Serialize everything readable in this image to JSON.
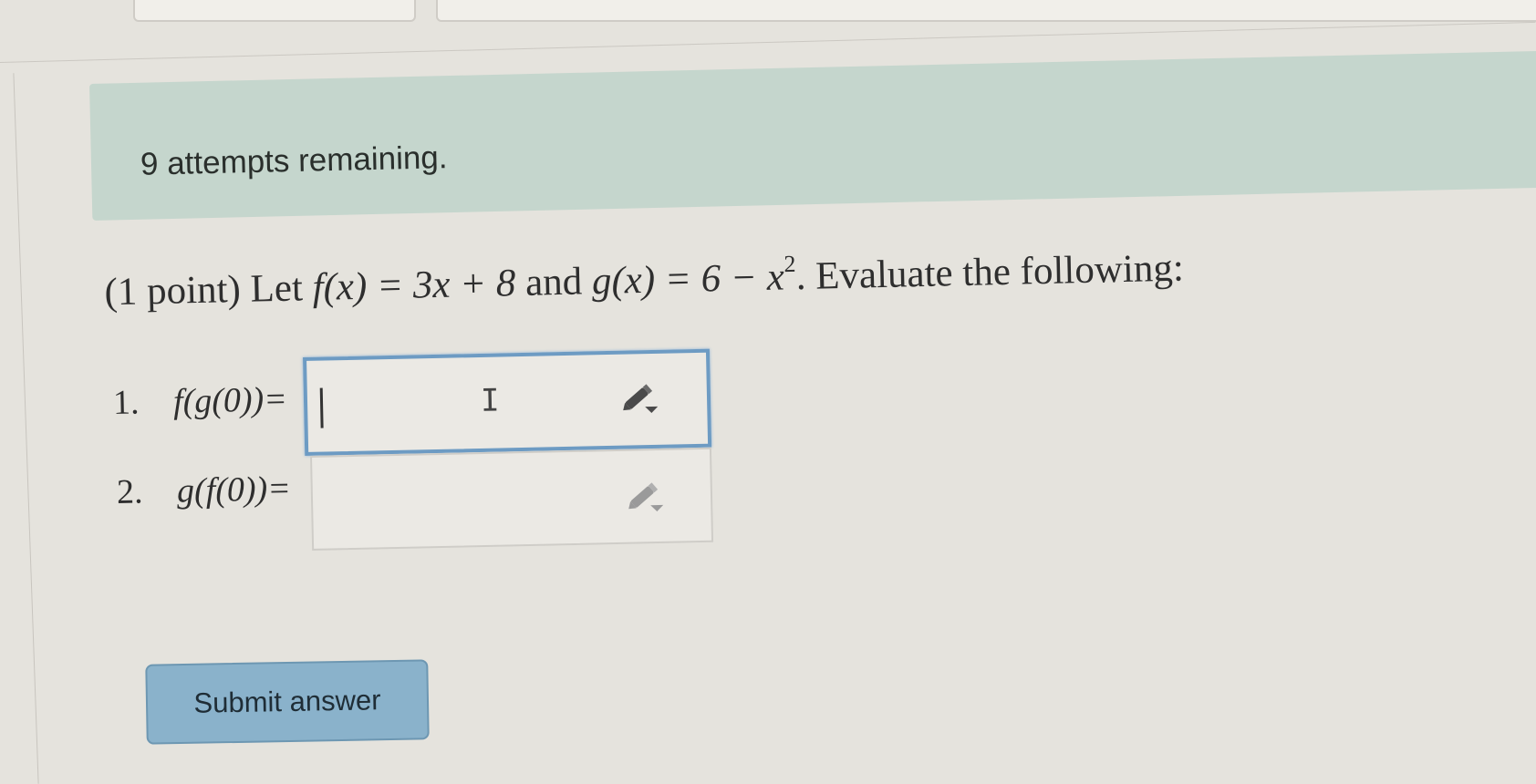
{
  "attempts": {
    "text": "9 attempts remaining."
  },
  "problem": {
    "points": "(1 point)",
    "let": "Let",
    "f_def": "f(x) = 3x + 8",
    "and": "and",
    "g_def_base": "g(x) = 6 − x",
    "g_def_exp": "2",
    "instruction": ". Evaluate the following:"
  },
  "questions": [
    {
      "number": "1.",
      "expr": "f(g(0))=",
      "value": "",
      "focused": true
    },
    {
      "number": "2.",
      "expr": "g(f(0))=",
      "value": "",
      "focused": false
    }
  ],
  "icons": {
    "cursor": "text-cursor",
    "ibeam": "ibeam-icon",
    "edit": "pencil-dropdown-icon"
  },
  "colors": {
    "banner": "#c5d6cd",
    "focus": "#6d9bc3",
    "submit": "#8ab2cb"
  },
  "submit": {
    "label": "Submit answer"
  }
}
